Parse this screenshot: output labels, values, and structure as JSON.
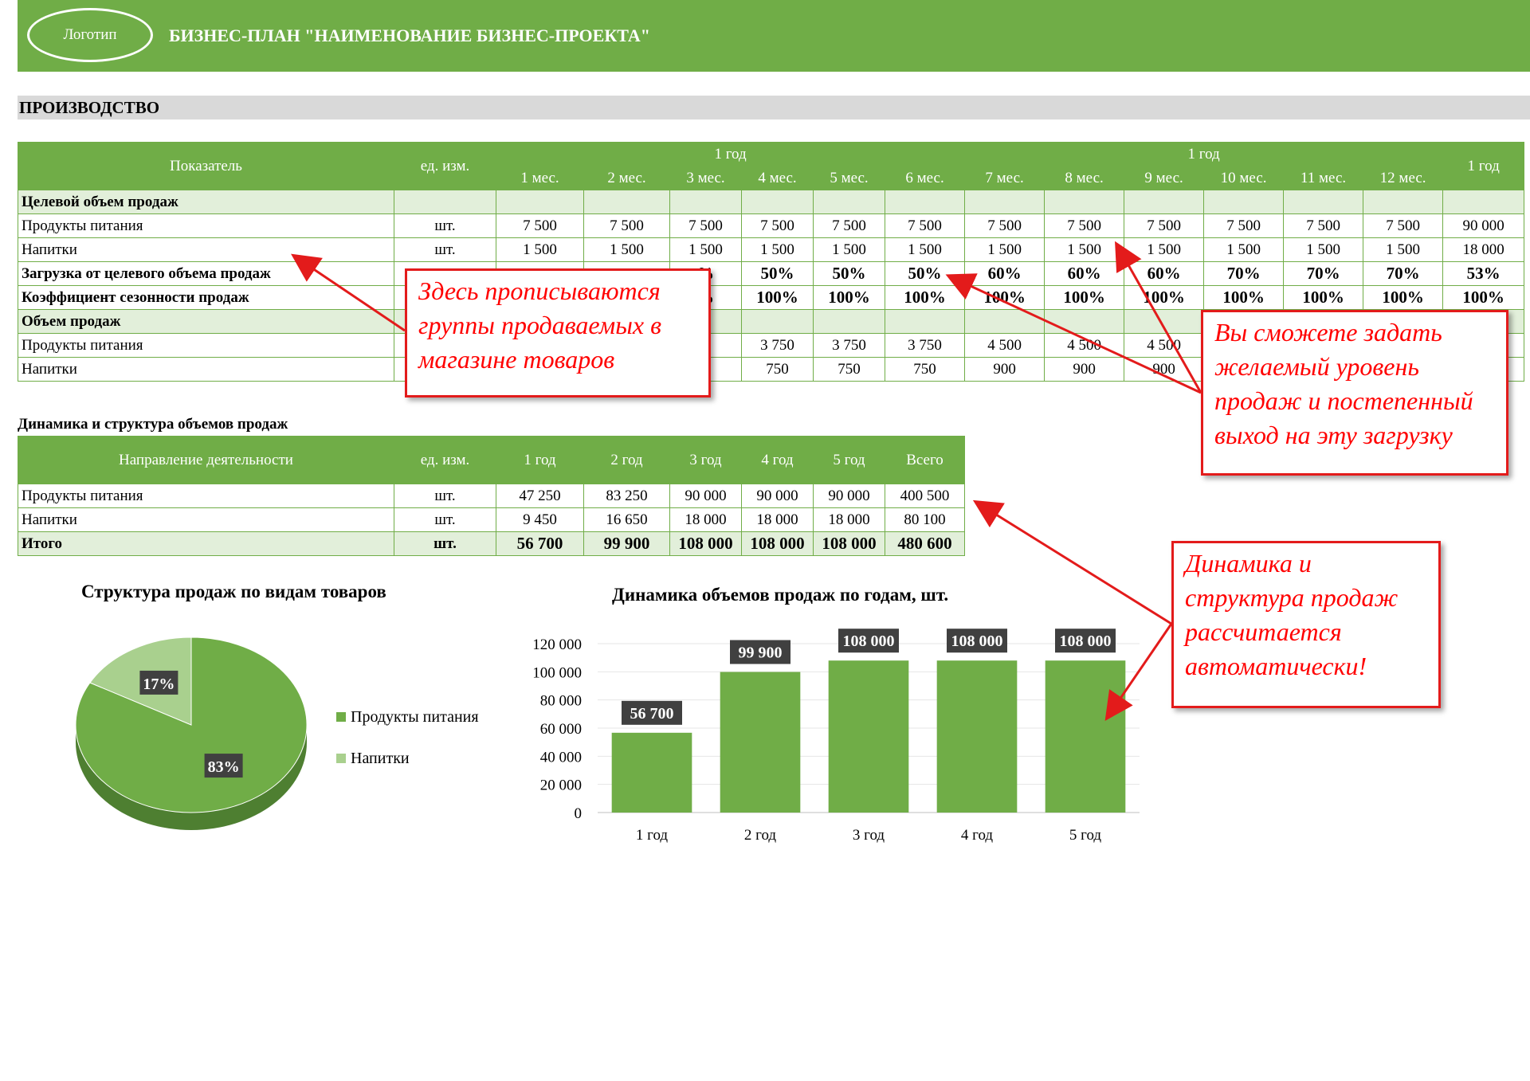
{
  "header": {
    "logo": "Логотип",
    "title": "БИЗНЕС-ПЛАН \"НАИМЕНОВАНИЕ БИЗНЕС-ПРОЕКТА\""
  },
  "section_title": "ПРОИЗВОДСТВО",
  "production": {
    "col_indicator": "Показатель",
    "col_unit": "ед. изм.",
    "year_group_1": "1 год",
    "year_group_2": "1 год",
    "year_total": "1 год",
    "months": [
      "1 мес.",
      "2 мес.",
      "3 мес.",
      "4 мес.",
      "5 мес.",
      "6 мес.",
      "7 мес.",
      "8 мес.",
      "9 мес.",
      "10 мес.",
      "11 мес.",
      "12 мес."
    ],
    "group_target": "Целевой объем продаж",
    "rows_target": [
      {
        "label": "Продукты питания",
        "unit": "шт.",
        "values": [
          "7 500",
          "7 500",
          "7 500",
          "7 500",
          "7 500",
          "7 500",
          "7 500",
          "7 500",
          "7 500",
          "7 500",
          "7 500",
          "7 500"
        ],
        "total": "90 000"
      },
      {
        "label": "Напитки",
        "unit": "шт.",
        "values": [
          "1 500",
          "1 500",
          "1 500",
          "1 500",
          "1 500",
          "1 500",
          "1 500",
          "1 500",
          "1 500",
          "1 500",
          "1 500",
          "1 500"
        ],
        "total": "18 000"
      }
    ],
    "row_load": {
      "label": "Загрузка от целевого объема продаж",
      "values": [
        "",
        "",
        "%",
        "50%",
        "50%",
        "50%",
        "60%",
        "60%",
        "60%",
        "70%",
        "70%",
        "70%"
      ],
      "total": "53%"
    },
    "row_season": {
      "label": "Коэффициент сезонности продаж",
      "values": [
        "",
        "",
        "%",
        "100%",
        "100%",
        "100%",
        "100%",
        "100%",
        "100%",
        "100%",
        "100%",
        "100%"
      ],
      "total": "100%"
    },
    "group_volume": "Объем продаж",
    "rows_volume": [
      {
        "label": "Продукты питания",
        "values": [
          "",
          "",
          "0",
          "3 750",
          "3 750",
          "3 750",
          "4 500",
          "4 500",
          "4 500",
          "",
          "",
          ""
        ],
        "total": ""
      },
      {
        "label": "Напитки",
        "values": [
          "",
          "",
          "0",
          "750",
          "750",
          "750",
          "900",
          "900",
          "900",
          "",
          "",
          ""
        ],
        "total": ""
      }
    ]
  },
  "dynamics": {
    "title": "Динамика и структура объемов продаж",
    "col_direction": "Направление деятельности",
    "col_unit": "ед. изм.",
    "years": [
      "1 год",
      "2 год",
      "3 год",
      "4 год",
      "5 год",
      "Всего"
    ],
    "rows": [
      {
        "label": "Продукты питания",
        "unit": "шт.",
        "values": [
          "47 250",
          "83 250",
          "90 000",
          "90 000",
          "90 000",
          "400 500"
        ]
      },
      {
        "label": "Напитки",
        "unit": "шт.",
        "values": [
          "9 450",
          "16 650",
          "18 000",
          "18 000",
          "18 000",
          "80 100"
        ]
      }
    ],
    "total": {
      "label": "Итого",
      "unit": "шт.",
      "values": [
        "56 700",
        "99 900",
        "108 000",
        "108 000",
        "108 000",
        "480 600"
      ]
    }
  },
  "callouts": {
    "left": "Здесь прописываются группы продаваемых в магазине товаров",
    "right": "Вы сможете задать желаемый уровень продаж и постепенный выход на эту загрузку",
    "bottom": "Динамика и структура продаж рассчитается автоматически!"
  },
  "colors": {
    "green": "#70ad47",
    "light_green": "#a9d08e",
    "dark_green": "#5a9a38",
    "red": "#ff0000"
  },
  "chart_data": [
    {
      "type": "pie",
      "title": "Структура  продаж по видам товаров",
      "categories": [
        "Продукты питания",
        "Напитки"
      ],
      "values": [
        83,
        17
      ],
      "labels": [
        "83%",
        "17%"
      ],
      "legend": "right"
    },
    {
      "type": "bar",
      "title": "Динамика объемов продаж по годам, шт.",
      "categories": [
        "1 год",
        "2 год",
        "3 год",
        "4 год",
        "5 год"
      ],
      "values": [
        56700,
        99900,
        108000,
        108000,
        108000
      ],
      "labels": [
        "56 700",
        "99 900",
        "108 000",
        "108 000",
        "108 000"
      ],
      "yticks": [
        "0",
        "20 000",
        "40 000",
        "60 000",
        "80 000",
        "100 000",
        "120 000"
      ],
      "ylim": [
        0,
        120000
      ],
      "grid": true
    }
  ]
}
